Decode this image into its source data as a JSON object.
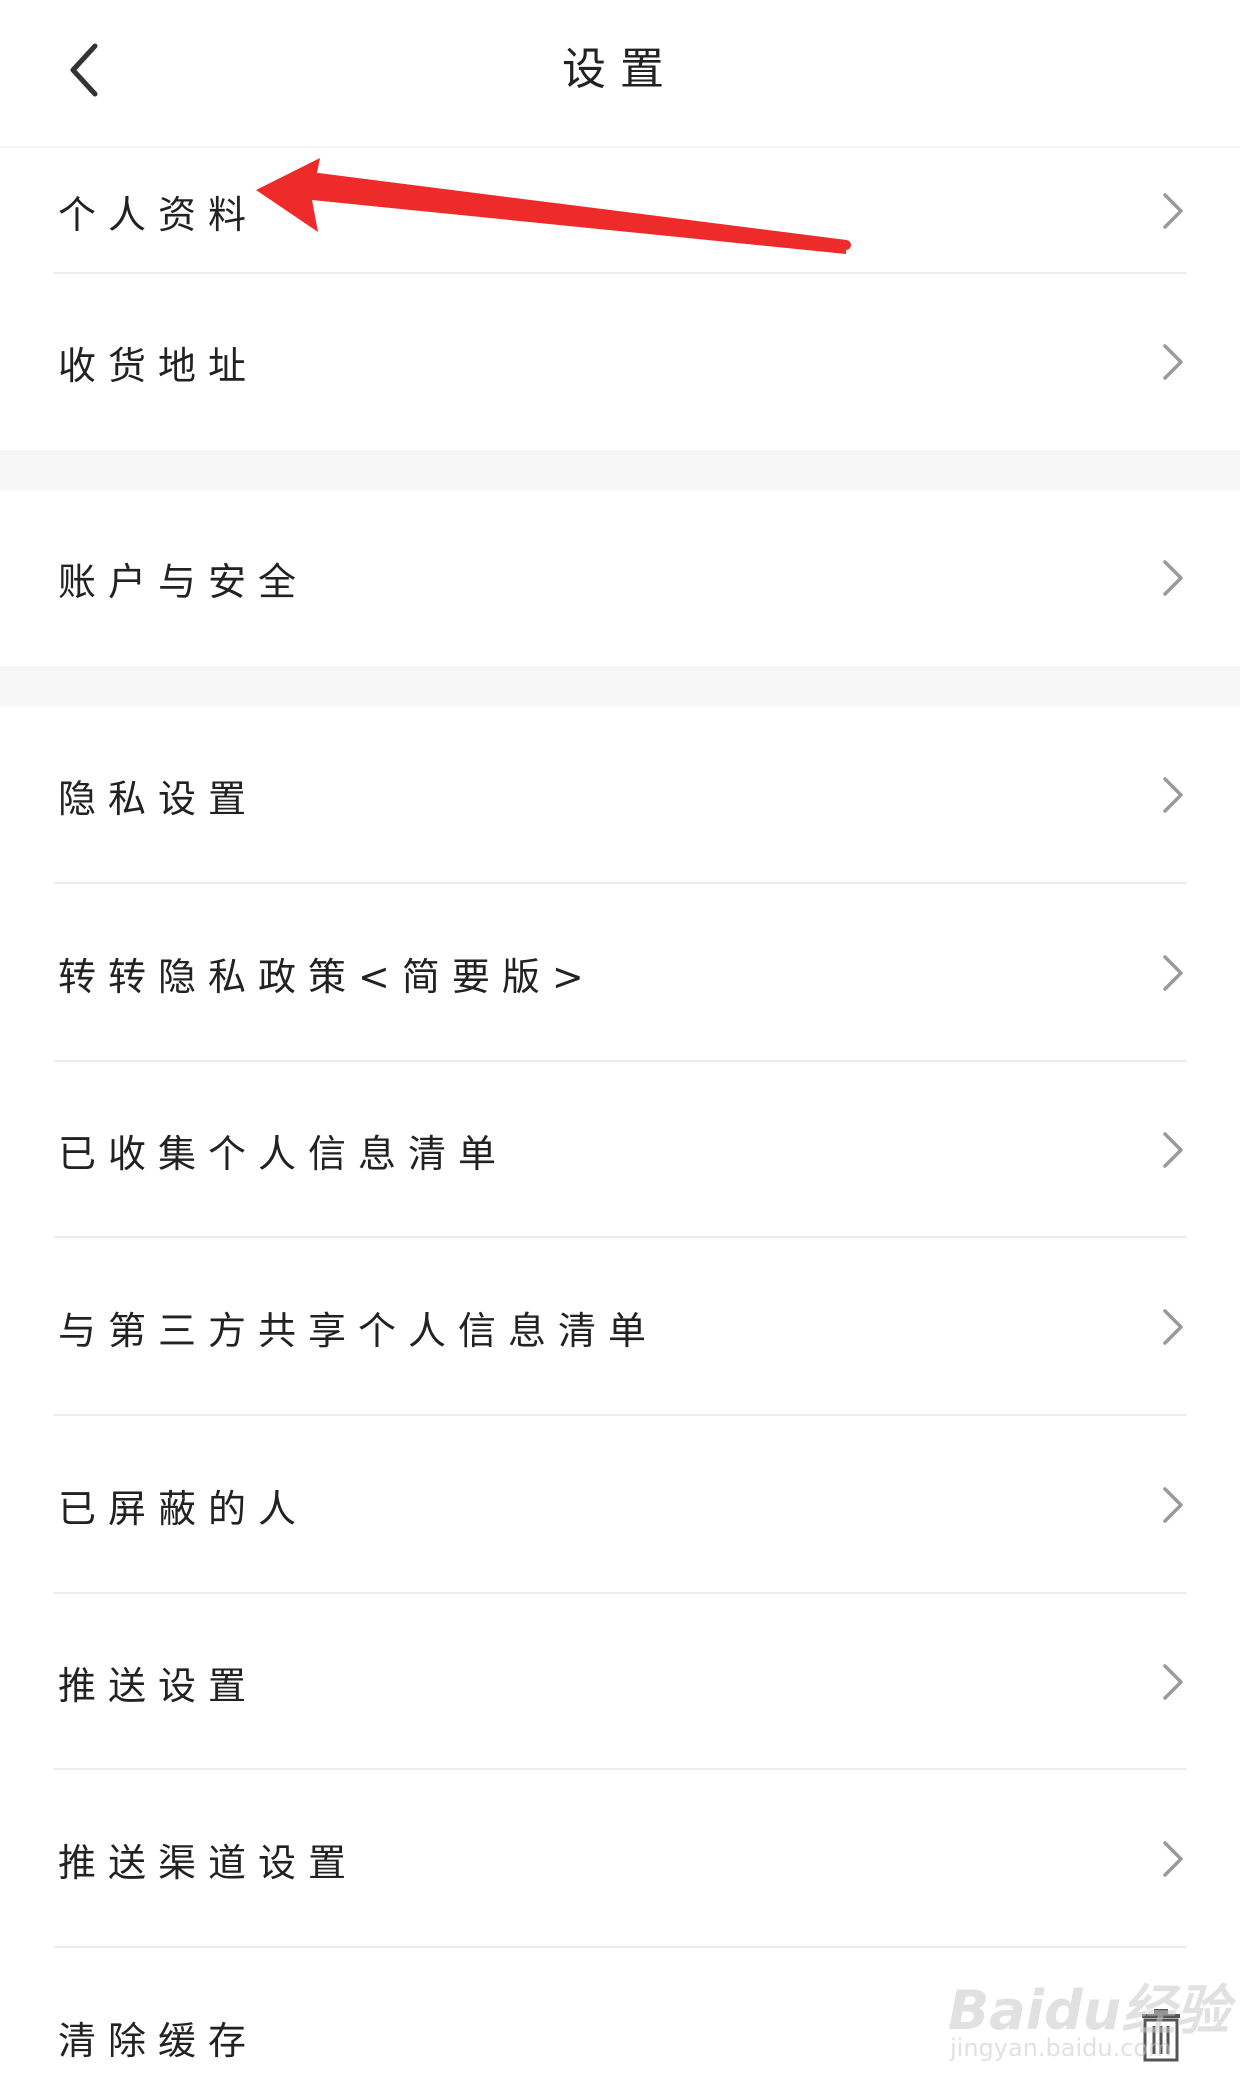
{
  "header": {
    "title": "设置",
    "back_icon": "chevron-left-icon"
  },
  "sections": [
    {
      "items": [
        {
          "label": "个人资料",
          "icon": "chevron-right-icon"
        },
        {
          "label": "收货地址",
          "icon": "chevron-right-icon"
        }
      ]
    },
    {
      "items": [
        {
          "label": "账户与安全",
          "icon": "chevron-right-icon"
        }
      ]
    },
    {
      "items": [
        {
          "label": "隐私设置",
          "icon": "chevron-right-icon"
        },
        {
          "label": "转转隐私政策<简要版>",
          "icon": "chevron-right-icon"
        },
        {
          "label": "已收集个人信息清单",
          "icon": "chevron-right-icon"
        },
        {
          "label": "与第三方共享个人信息清单",
          "icon": "chevron-right-icon"
        },
        {
          "label": "已屏蔽的人",
          "icon": "chevron-right-icon"
        },
        {
          "label": "推送设置",
          "icon": "chevron-right-icon"
        },
        {
          "label": "推送渠道设置",
          "icon": "chevron-right-icon"
        },
        {
          "label": "清除缓存",
          "icon": "trash-icon"
        }
      ]
    }
  ],
  "annotation": {
    "arrow_color": "#ee2b2b",
    "icon": "red-arrow-icon"
  },
  "watermark": {
    "brand": "Baidu经验",
    "url": "jingyan.baidu.com"
  },
  "colors": {
    "background": "#ffffff",
    "gap": "#f7f7f7",
    "divider": "#ebebeb",
    "text": "#222222",
    "chevron": "#9a9a9a"
  }
}
